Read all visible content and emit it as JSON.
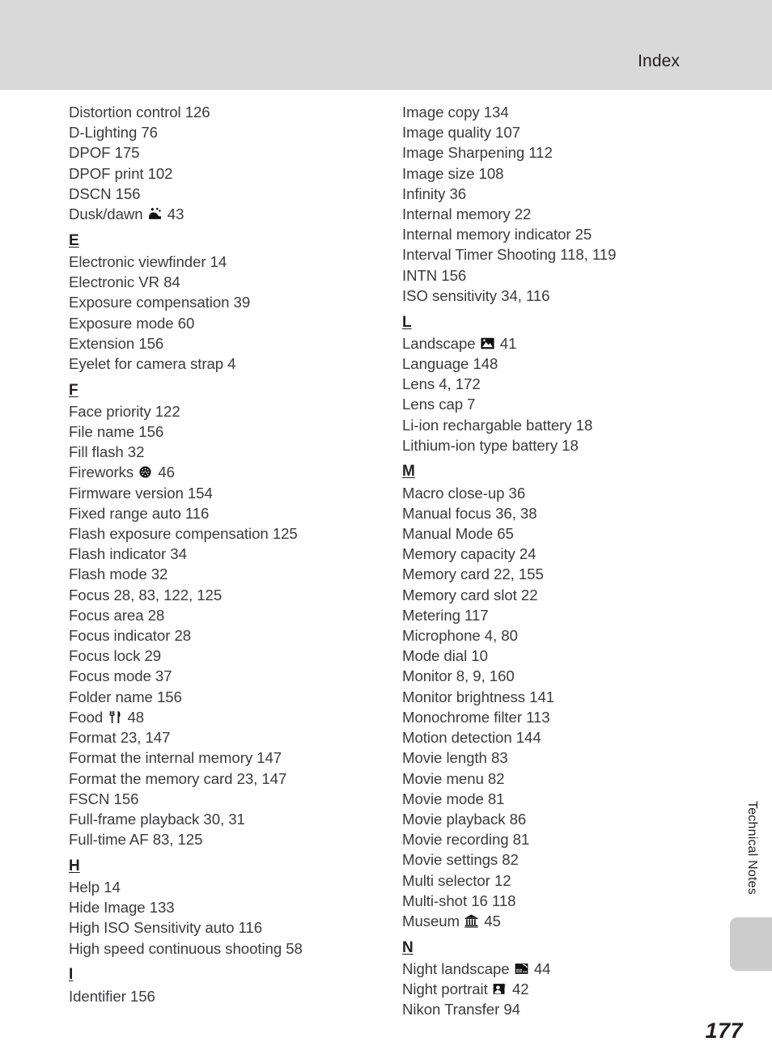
{
  "header": {
    "title": "Index"
  },
  "side": {
    "chapter_tab_label": "Technical Notes",
    "page_number": "177"
  },
  "columns": [
    {
      "name": "left",
      "blocks": [
        {
          "letter": null,
          "entries": [
            {
              "text": "Distortion control 126",
              "icon": null
            },
            {
              "text": "D-Lighting 76",
              "icon": null
            },
            {
              "text": "DPOF 175",
              "icon": null
            },
            {
              "text": "DPOF print 102",
              "icon": null
            },
            {
              "text": "DSCN 156",
              "icon": null
            },
            {
              "label": "Dusk/dawn",
              "icon": "dusk-dawn-icon",
              "pages": "43"
            }
          ]
        },
        {
          "letter": "E",
          "entries": [
            {
              "text": "Electronic viewfinder 14",
              "icon": null
            },
            {
              "text": "Electronic VR 84",
              "icon": null
            },
            {
              "text": "Exposure compensation 39",
              "icon": null
            },
            {
              "text": "Exposure mode 60",
              "icon": null
            },
            {
              "text": "Extension 156",
              "icon": null
            },
            {
              "text": "Eyelet for camera strap 4",
              "icon": null
            }
          ]
        },
        {
          "letter": "F",
          "entries": [
            {
              "text": "Face priority 122",
              "icon": null
            },
            {
              "text": "File name 156",
              "icon": null
            },
            {
              "text": "Fill flash 32",
              "icon": null
            },
            {
              "label": "Fireworks",
              "icon": "fireworks-icon",
              "pages": "46"
            },
            {
              "text": "Firmware version 154",
              "icon": null
            },
            {
              "text": "Fixed range auto 116",
              "icon": null
            },
            {
              "text": "Flash exposure compensation 125",
              "icon": null
            },
            {
              "text": "Flash indicator 34",
              "icon": null
            },
            {
              "text": "Flash mode 32",
              "icon": null
            },
            {
              "text": "Focus 28, 83, 122, 125",
              "icon": null
            },
            {
              "text": "Focus area 28",
              "icon": null
            },
            {
              "text": "Focus indicator 28",
              "icon": null
            },
            {
              "text": "Focus lock 29",
              "icon": null
            },
            {
              "text": "Focus mode 37",
              "icon": null
            },
            {
              "text": "Folder name 156",
              "icon": null
            },
            {
              "label": "Food",
              "icon": "food-icon",
              "pages": "48"
            },
            {
              "text": "Format 23, 147",
              "icon": null
            },
            {
              "text": "Format the internal memory 147",
              "icon": null
            },
            {
              "text": "Format the memory card 23, 147",
              "icon": null
            },
            {
              "text": "FSCN 156",
              "icon": null
            },
            {
              "text": "Full-frame playback 30, 31",
              "icon": null
            },
            {
              "text": "Full-time AF 83, 125",
              "icon": null
            }
          ]
        },
        {
          "letter": "H",
          "entries": [
            {
              "text": "Help 14",
              "icon": null
            },
            {
              "text": "Hide Image 133",
              "icon": null
            },
            {
              "text": "High ISO Sensitivity auto 116",
              "icon": null
            },
            {
              "text": "High speed continuous shooting 58",
              "icon": null
            }
          ]
        },
        {
          "letter": "I",
          "entries": [
            {
              "text": "Identifier 156",
              "icon": null
            }
          ]
        }
      ]
    },
    {
      "name": "right",
      "blocks": [
        {
          "letter": null,
          "entries": [
            {
              "text": "Image copy 134",
              "icon": null
            },
            {
              "text": "Image quality 107",
              "icon": null
            },
            {
              "text": "Image Sharpening 112",
              "icon": null
            },
            {
              "text": "Image size 108",
              "icon": null
            },
            {
              "text": "Infinity 36",
              "icon": null
            },
            {
              "text": "Internal memory 22",
              "icon": null
            },
            {
              "text": "Internal memory indicator 25",
              "icon": null
            },
            {
              "text": "Interval Timer Shooting 118, 119",
              "icon": null
            },
            {
              "text": "INTN 156",
              "icon": null
            },
            {
              "text": "ISO sensitivity 34, 116",
              "icon": null
            }
          ]
        },
        {
          "letter": "L",
          "entries": [
            {
              "label": "Landscape",
              "icon": "landscape-icon",
              "pages": "41"
            },
            {
              "text": "Language 148",
              "icon": null
            },
            {
              "text": "Lens 4, 172",
              "icon": null
            },
            {
              "text": "Lens cap 7",
              "icon": null
            },
            {
              "text": "Li-ion rechargable battery 18",
              "icon": null
            },
            {
              "text": "Lithium-ion type battery 18",
              "icon": null
            }
          ]
        },
        {
          "letter": "M",
          "entries": [
            {
              "text": "Macro close-up 36",
              "icon": null
            },
            {
              "text": "Manual focus 36, 38",
              "icon": null
            },
            {
              "text": "Manual Mode 65",
              "icon": null
            },
            {
              "text": "Memory capacity 24",
              "icon": null
            },
            {
              "text": "Memory card 22, 155",
              "icon": null
            },
            {
              "text": "Memory card slot 22",
              "icon": null
            },
            {
              "text": "Metering 117",
              "icon": null
            },
            {
              "text": "Microphone 4, 80",
              "icon": null
            },
            {
              "text": "Mode dial 10",
              "icon": null
            },
            {
              "text": "Monitor 8, 9, 160",
              "icon": null
            },
            {
              "text": "Monitor brightness 141",
              "icon": null
            },
            {
              "text": "Monochrome filter 113",
              "icon": null
            },
            {
              "text": "Motion detection 144",
              "icon": null
            },
            {
              "text": "Movie length 83",
              "icon": null
            },
            {
              "text": "Movie menu 82",
              "icon": null
            },
            {
              "text": "Movie mode 81",
              "icon": null
            },
            {
              "text": "Movie playback 86",
              "icon": null
            },
            {
              "text": "Movie recording 81",
              "icon": null
            },
            {
              "text": "Movie settings 82",
              "icon": null
            },
            {
              "text": "Multi selector 12",
              "icon": null
            },
            {
              "text": "Multi-shot 16 118",
              "icon": null
            },
            {
              "label": "Museum",
              "icon": "museum-icon",
              "pages": "45"
            }
          ]
        },
        {
          "letter": "N",
          "entries": [
            {
              "label": "Night landscape",
              "icon": "night-landscape-icon",
              "pages": "44"
            },
            {
              "label": "Night portrait",
              "icon": "night-portrait-icon",
              "pages": "42"
            },
            {
              "text": "Nikon Transfer 94",
              "icon": null
            }
          ]
        }
      ]
    }
  ]
}
